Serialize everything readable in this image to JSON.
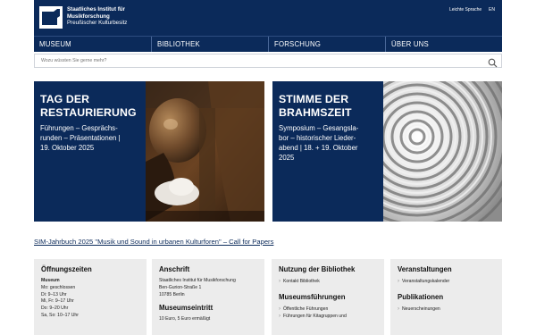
{
  "header": {
    "institution_line1": "Staatliches Institut für",
    "institution_line2": "Musikforschung",
    "institution_line3": "Preußischer Kulturbesitz",
    "easy_language": "Leichte Sprache",
    "language": "EN"
  },
  "nav": {
    "items": [
      {
        "label": "MUSEUM"
      },
      {
        "label": "BIBLIOTHEK"
      },
      {
        "label": "FORSCHUNG"
      },
      {
        "label": "ÜBER UNS"
      }
    ]
  },
  "search": {
    "placeholder": "Wozu wüssten Sie gerne mehr?",
    "icon": "search-icon"
  },
  "teasers": [
    {
      "title_line1": "TAG DER",
      "title_line2": "RESTAURIERUNG",
      "sub_line1": "Führungen – Gesprächs-",
      "sub_line2": "runden – Präsentationen |",
      "sub_line3": "19. Oktober 2025"
    },
    {
      "title_line1": "STIMME DER",
      "title_line2": "BRAHMSZEIT",
      "sub_line1": "Symposium – Gesangsla-",
      "sub_line2": "bor – historischer Lieder-",
      "sub_line3": "abend | 18. + 19. Oktober",
      "sub_line4": "2025"
    }
  ],
  "call_for_papers": "SIM-Jahrbuch 2025 \"Musik und Sound in urbanen Kulturforen\" – Call for Papers",
  "cards": {
    "hours": {
      "title": "Öffnungszeiten",
      "section": "Museum",
      "lines": [
        "Mo: geschlossen",
        "Di: 9–13 Uhr",
        "Mi, Fr: 9–17 Uhr",
        "Do: 9–20 Uhr",
        "Sa, So: 10–17 Uhr"
      ]
    },
    "address": {
      "title": "Anschrift",
      "lines": [
        "Staatliches Institut für Musikforschung",
        "Ben-Gurion-Straße 1",
        "10785 Berlin"
      ],
      "title2": "Museumseintritt",
      "entry": "10 Euro, 5 Euro ermäßigt"
    },
    "library": {
      "title": "Nutzung der Bibliothek",
      "links": [
        "Kontakt Bibliothek"
      ],
      "title2": "Museumsführungen",
      "links2": [
        "Öffentliche Führungen",
        "Führungen für Kitagruppen und"
      ]
    },
    "events": {
      "title": "Veranstaltungen",
      "links": [
        "Veranstaltungskalender"
      ],
      "title2": "Publikationen",
      "links2": [
        "Neuerscheinungen"
      ]
    }
  },
  "colors": {
    "navy": "#0b2a5a",
    "card_bg": "#ececec"
  }
}
